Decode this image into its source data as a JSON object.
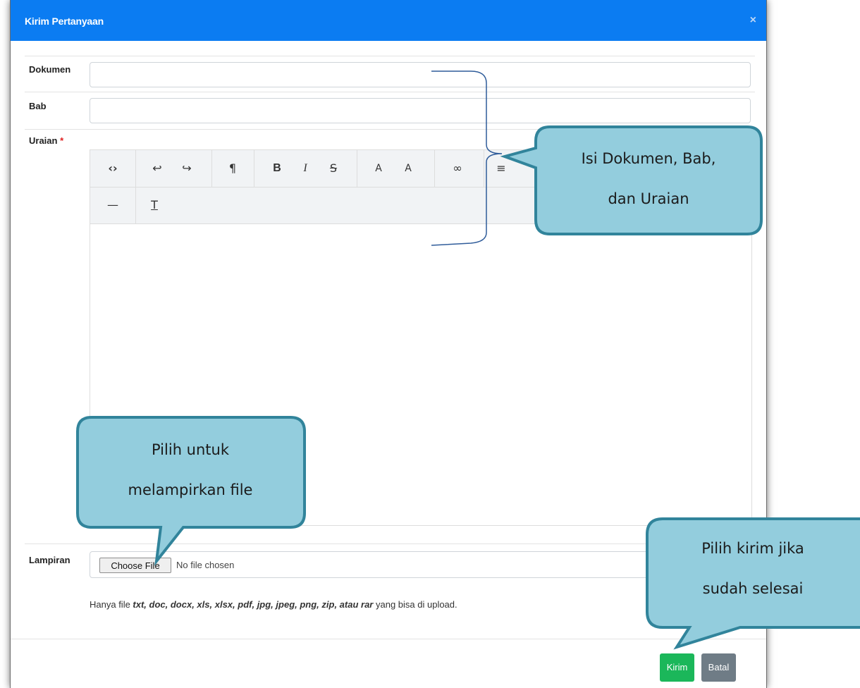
{
  "modal": {
    "title": "Kirim Pertanyaan",
    "close_icon": "×"
  },
  "form": {
    "dokumen": {
      "label": "Dokumen",
      "value": "",
      "placeholder": ""
    },
    "bab": {
      "label": "Bab",
      "value": "",
      "placeholder": ""
    },
    "uraian": {
      "label": "Uraian",
      "required_mark": "*"
    },
    "lampiran": {
      "label": "Lampiran",
      "choose_label": "Choose File",
      "no_file_text": "No file chosen"
    },
    "help": {
      "prefix": "Hanya file ",
      "types": "txt, doc, docx, xls, xlsx, pdf, jpg, jpeg, png, zip, atau rar",
      "suffix": " yang bisa di upload."
    }
  },
  "toolbar": {
    "row1": [
      {
        "name": "code-view-icon",
        "glyph": "‹›"
      },
      {
        "name": "undo-icon",
        "glyph": "↩"
      },
      {
        "name": "redo-icon",
        "glyph": "↪"
      },
      {
        "name": "paragraph-icon",
        "glyph": "¶"
      },
      {
        "name": "bold-icon",
        "glyph": "B"
      },
      {
        "name": "italic-icon",
        "glyph": "I"
      },
      {
        "name": "strikethrough-icon",
        "glyph": "S"
      },
      {
        "name": "superscript-icon",
        "glyph": "A"
      },
      {
        "name": "subscript-icon",
        "glyph": "A"
      },
      {
        "name": "link-icon",
        "glyph": "∞"
      },
      {
        "name": "align-icon",
        "glyph": "≡"
      }
    ],
    "row2": [
      {
        "name": "horizontal-rule-icon",
        "glyph": "—"
      },
      {
        "name": "clear-format-icon",
        "glyph": "T"
      }
    ]
  },
  "footer": {
    "kirim_label": "Kirim",
    "batal_label": "Batal"
  },
  "callouts": {
    "isi": [
      "Isi Dokumen, Bab,",
      "dan Uraian"
    ],
    "pilih_file": [
      "Pilih untuk",
      "melampirkan file"
    ],
    "pilih_kirim": [
      "Pilih kirim jika",
      "sudah selesai"
    ]
  },
  "colors": {
    "header": "#0b7cf2",
    "kirim": "#1bb75a",
    "batal": "#6f7c86",
    "callout_fill": "#93cddd",
    "callout_stroke": "#31849b"
  }
}
